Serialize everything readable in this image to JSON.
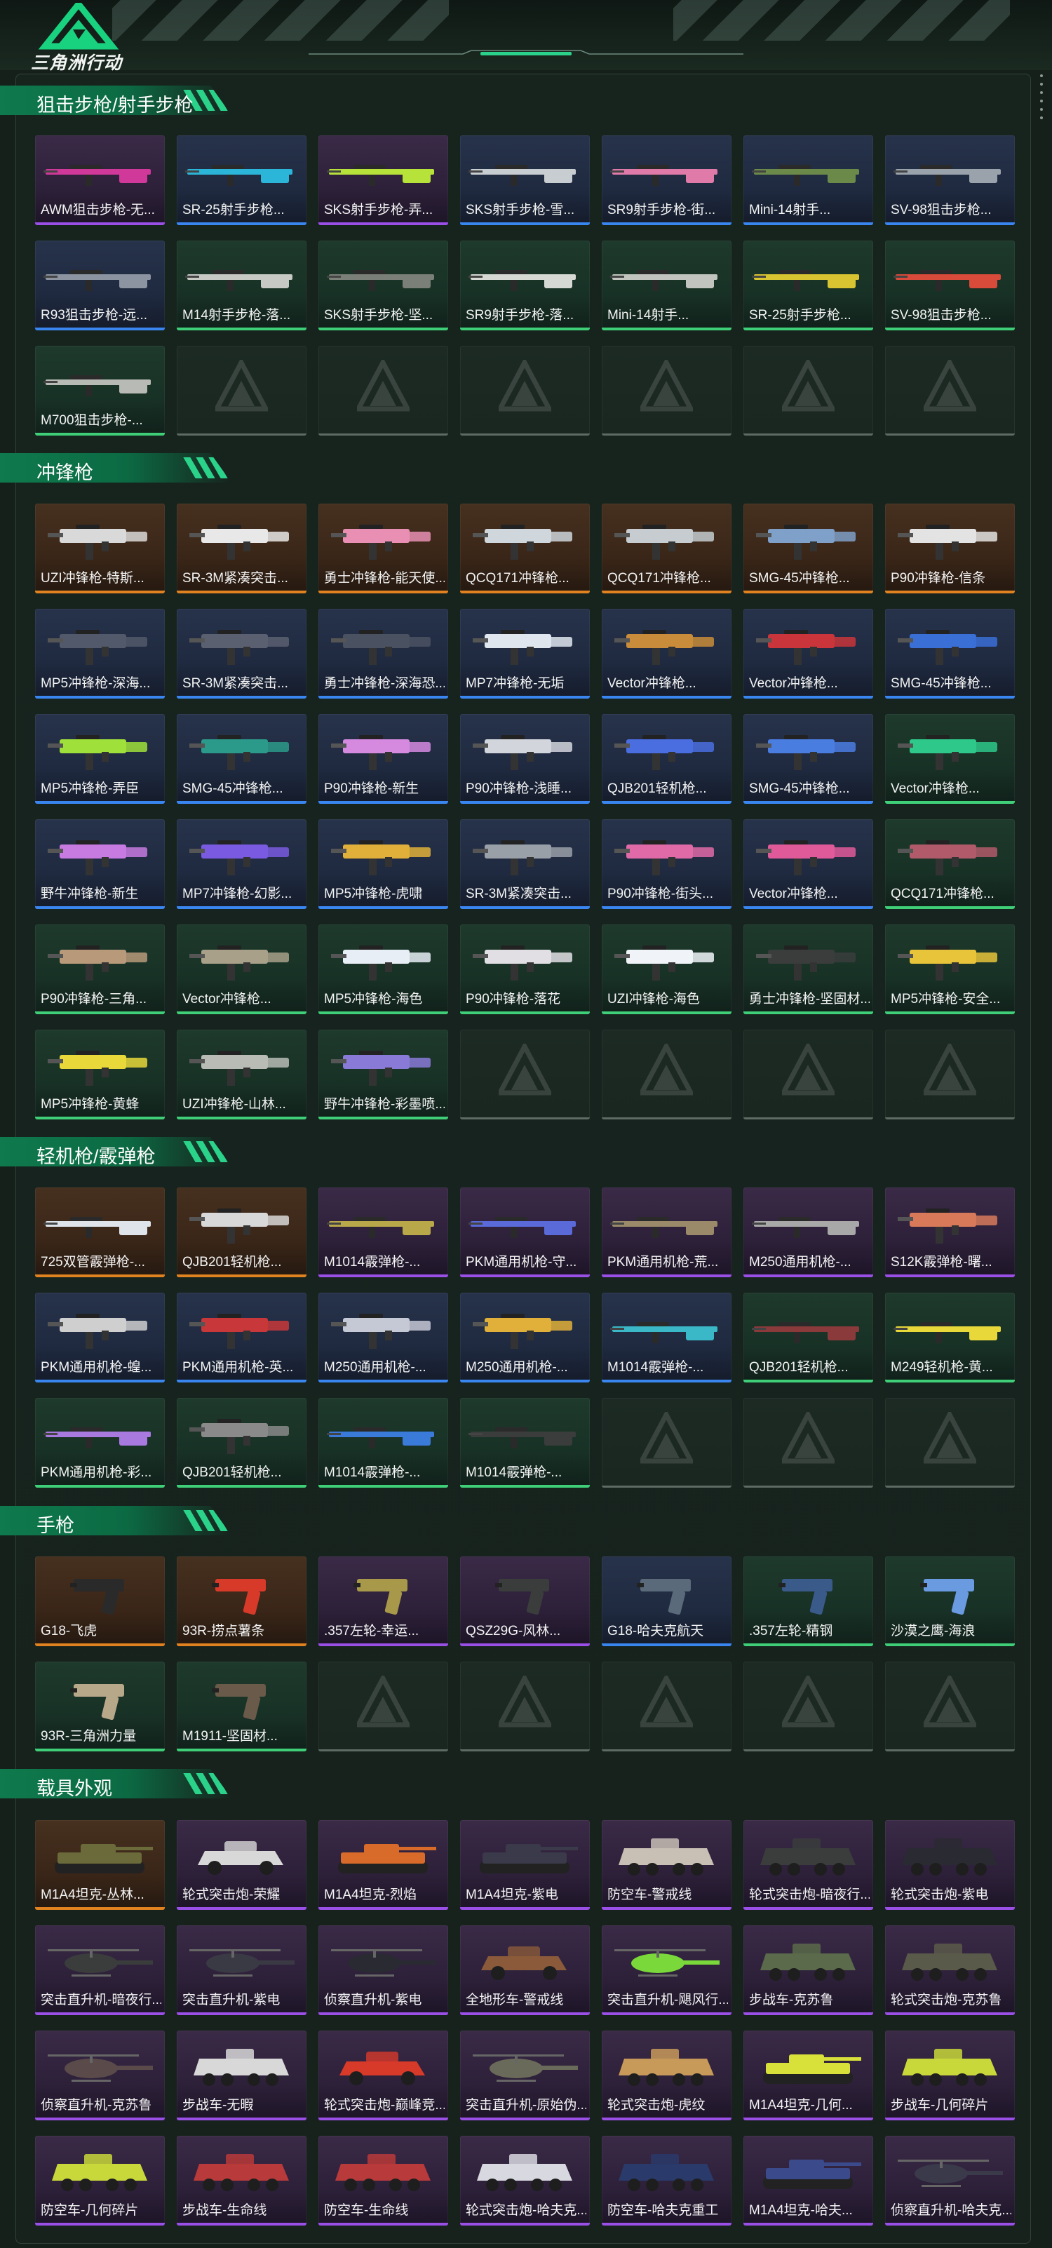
{
  "app": {
    "logo_text": "三角洲行动"
  },
  "colors": {
    "accent": "#0e7a4d",
    "gold": "#e0821f",
    "purple": "#9a4fe6",
    "blue": "#3a86f0",
    "green": "#3fcf78",
    "empty": "#5d6b64"
  },
  "sections": [
    {
      "title": "狙击步枪/射手步枪",
      "items": [
        {
          "label": "AWM狙击步枪-无...",
          "quality": "purple",
          "kind": "rifle",
          "color": "#d0389a"
        },
        {
          "label": "SR-25射手步枪...",
          "quality": "blue",
          "kind": "rifle",
          "color": "#2bb5d8"
        },
        {
          "label": "SKS射手步枪-弄...",
          "quality": "purple",
          "kind": "rifle",
          "color": "#b7e23a"
        },
        {
          "label": "SKS射手步枪-雪...",
          "quality": "blue",
          "kind": "rifle",
          "color": "#c8cdd2"
        },
        {
          "label": "SR9射手步枪-街...",
          "quality": "blue",
          "kind": "rifle",
          "color": "#e07aa8"
        },
        {
          "label": "Mini-14射手...",
          "quality": "blue",
          "kind": "rifle",
          "color": "#6b8a4a"
        },
        {
          "label": "SV-98狙击步枪...",
          "quality": "blue",
          "kind": "rifle",
          "color": "#9aa3ab"
        },
        {
          "label": "R93狙击步枪-远...",
          "quality": "blue",
          "kind": "rifle",
          "color": "#8b94a0"
        },
        {
          "label": "M14射手步枪-落...",
          "quality": "green",
          "kind": "rifle",
          "color": "#c7c9c4"
        },
        {
          "label": "SKS射手步枪-坚...",
          "quality": "green",
          "kind": "rifle",
          "color": "#7a7f77"
        },
        {
          "label": "SR9射手步枪-落...",
          "quality": "green",
          "kind": "rifle",
          "color": "#d5d8d3"
        },
        {
          "label": "Mini-14射手...",
          "quality": "green",
          "kind": "rifle",
          "color": "#c1c4bf"
        },
        {
          "label": "SR-25射手步枪...",
          "quality": "green",
          "kind": "rifle",
          "color": "#d8c431"
        },
        {
          "label": "SV-98狙击步枪...",
          "quality": "green",
          "kind": "rifle",
          "color": "#d84a3a"
        },
        {
          "label": "M700狙击步枪-...",
          "quality": "green",
          "kind": "rifle",
          "color": "#b8bab5"
        },
        {
          "label": "",
          "quality": "empty"
        },
        {
          "label": "",
          "quality": "empty"
        },
        {
          "label": "",
          "quality": "empty"
        },
        {
          "label": "",
          "quality": "empty"
        },
        {
          "label": "",
          "quality": "empty"
        },
        {
          "label": "",
          "quality": "empty"
        }
      ]
    },
    {
      "title": "冲锋枪",
      "items": [
        {
          "label": "UZI冲锋枪-特斯...",
          "quality": "gold",
          "kind": "smg",
          "color": "#d9d9d9"
        },
        {
          "label": "SR-3M紧凑突击...",
          "quality": "gold",
          "kind": "smg",
          "color": "#e8e8e8"
        },
        {
          "label": "勇士冲锋枪-能天使...",
          "quality": "gold",
          "kind": "smg",
          "color": "#e98fb4"
        },
        {
          "label": "QCQ171冲锋枪...",
          "quality": "gold",
          "kind": "smg",
          "color": "#cfd6dc"
        },
        {
          "label": "QCQ171冲锋枪...",
          "quality": "gold",
          "kind": "smg",
          "color": "#c6ccd0"
        },
        {
          "label": "SMG-45冲锋枪...",
          "quality": "gold",
          "kind": "smg",
          "color": "#7fa0c8"
        },
        {
          "label": "P90冲锋枪-信条",
          "quality": "gold",
          "kind": "smg",
          "color": "#e3e3e3"
        },
        {
          "label": "MP5冲锋枪-深海...",
          "quality": "blue",
          "kind": "smg",
          "color": "#51596a"
        },
        {
          "label": "SR-3M紧凑突击...",
          "quality": "blue",
          "kind": "smg",
          "color": "#5a6070"
        },
        {
          "label": "勇士冲锋枪-深海恐...",
          "quality": "blue",
          "kind": "smg",
          "color": "#4a5262"
        },
        {
          "label": "MP7冲锋枪-无垢",
          "quality": "blue",
          "kind": "smg",
          "color": "#dfe6ee"
        },
        {
          "label": "Vector冲锋枪...",
          "quality": "blue",
          "kind": "smg",
          "color": "#c98c3a"
        },
        {
          "label": "Vector冲锋枪...",
          "quality": "blue",
          "kind": "smg",
          "color": "#c9353a"
        },
        {
          "label": "SMG-45冲锋枪...",
          "quality": "blue",
          "kind": "smg",
          "color": "#3a6fd6"
        },
        {
          "label": "MP5冲锋枪-弄臣",
          "quality": "blue",
          "kind": "smg",
          "color": "#9fe03a"
        },
        {
          "label": "SMG-45冲锋枪...",
          "quality": "blue",
          "kind": "smg",
          "color": "#2b9a8a"
        },
        {
          "label": "P90冲锋枪-新生",
          "quality": "blue",
          "kind": "smg",
          "color": "#d58ae0"
        },
        {
          "label": "P90冲锋枪-浅睡...",
          "quality": "blue",
          "kind": "smg",
          "color": "#d2d5dc"
        },
        {
          "label": "QJB201轻机枪...",
          "quality": "blue",
          "kind": "smg",
          "color": "#4a6de0"
        },
        {
          "label": "SMG-45冲锋枪...",
          "quality": "blue",
          "kind": "smg",
          "color": "#4a7de0"
        },
        {
          "label": "Vector冲锋枪...",
          "quality": "green",
          "kind": "smg",
          "color": "#2ec88a"
        },
        {
          "label": "野牛冲锋枪-新生",
          "quality": "blue",
          "kind": "smg",
          "color": "#c77ae0"
        },
        {
          "label": "MP7冲锋枪-幻影...",
          "quality": "blue",
          "kind": "smg",
          "color": "#7a5ae0"
        },
        {
          "label": "MP5冲锋枪-虎啸",
          "quality": "blue",
          "kind": "smg",
          "color": "#e0b03a"
        },
        {
          "label": "SR-3M紧凑突击...",
          "quality": "blue",
          "kind": "smg",
          "color": "#9aa0a8"
        },
        {
          "label": "P90冲锋枪-街头...",
          "quality": "blue",
          "kind": "smg",
          "color": "#e06aa8"
        },
        {
          "label": "Vector冲锋枪...",
          "quality": "blue",
          "kind": "smg",
          "color": "#e05a9a"
        },
        {
          "label": "QCQ171冲锋枪...",
          "quality": "green",
          "kind": "smg",
          "color": "#b05a6a"
        },
        {
          "label": "P90冲锋枪-三角...",
          "quality": "green",
          "kind": "smg",
          "color": "#b89a7a"
        },
        {
          "label": "Vector冲锋枪...",
          "quality": "green",
          "kind": "smg",
          "color": "#a8a088"
        },
        {
          "label": "MP5冲锋枪-海色",
          "quality": "green",
          "kind": "smg",
          "color": "#e8eef5"
        },
        {
          "label": "P90冲锋枪-落花",
          "quality": "green",
          "kind": "smg",
          "color": "#e2dfe4"
        },
        {
          "label": "UZI冲锋枪-海色",
          "quality": "green",
          "kind": "smg",
          "color": "#f0f4f8"
        },
        {
          "label": "勇士冲锋枪-坚固材...",
          "quality": "green",
          "kind": "smg",
          "color": "#3a3d3c"
        },
        {
          "label": "MP5冲锋枪-安全...",
          "quality": "green",
          "kind": "smg",
          "color": "#e8c43a"
        },
        {
          "label": "MP5冲锋枪-黄蜂",
          "quality": "green",
          "kind": "smg",
          "color": "#e8d83a"
        },
        {
          "label": "UZI冲锋枪-山林...",
          "quality": "green",
          "kind": "smg",
          "color": "#b8bcb5"
        },
        {
          "label": "野牛冲锋枪-彩墨喷...",
          "quality": "green",
          "kind": "smg",
          "color": "#8a7ad8"
        },
        {
          "label": "",
          "quality": "empty"
        },
        {
          "label": "",
          "quality": "empty"
        },
        {
          "label": "",
          "quality": "empty"
        },
        {
          "label": "",
          "quality": "empty"
        }
      ]
    },
    {
      "title": "轻机枪/霰弹枪",
      "items": [
        {
          "label": "725双管霰弹枪-...",
          "quality": "gold",
          "kind": "rifle",
          "color": "#dfe4ea"
        },
        {
          "label": "QJB201轻机枪...",
          "quality": "gold",
          "kind": "smg",
          "color": "#d8d8d8"
        },
        {
          "label": "M1014霰弹枪-...",
          "quality": "purple",
          "kind": "rifle",
          "color": "#b8a84a"
        },
        {
          "label": "PKM通用机枪-守...",
          "quality": "purple",
          "kind": "rifle",
          "color": "#5a6ad8"
        },
        {
          "label": "PKM通用机枪-荒...",
          "quality": "purple",
          "kind": "rifle",
          "color": "#9a8a6a"
        },
        {
          "label": "M250通用机枪-...",
          "quality": "purple",
          "kind": "rifle",
          "color": "#a8a8a8"
        },
        {
          "label": "S12K霰弹枪-曙...",
          "quality": "purple",
          "kind": "smg",
          "color": "#d87a5a"
        },
        {
          "label": "PKM通用机枪-蝗...",
          "quality": "blue",
          "kind": "smg",
          "color": "#cfcfcf"
        },
        {
          "label": "PKM通用机枪-英...",
          "quality": "blue",
          "kind": "smg",
          "color": "#c8383a"
        },
        {
          "label": "M250通用机枪-...",
          "quality": "blue",
          "kind": "smg",
          "color": "#c5c8d5"
        },
        {
          "label": "M250通用机枪-...",
          "quality": "blue",
          "kind": "smg",
          "color": "#e0b03a"
        },
        {
          "label": "M1014霰弹枪-...",
          "quality": "blue",
          "kind": "rifle",
          "color": "#3ab8c8"
        },
        {
          "label": "QJB201轻机枪...",
          "quality": "green",
          "kind": "rifle",
          "color": "#8a3a3a"
        },
        {
          "label": "M249轻机枪-黄...",
          "quality": "green",
          "kind": "rifle",
          "color": "#e8d83a"
        },
        {
          "label": "PKM通用机枪-彩...",
          "quality": "green",
          "kind": "rifle",
          "color": "#a87ae0"
        },
        {
          "label": "QJB201轻机枪...",
          "quality": "green",
          "kind": "smg",
          "color": "#8a8a8a"
        },
        {
          "label": "M1014霰弹枪-...",
          "quality": "green",
          "kind": "rifle",
          "color": "#3a7ad8"
        },
        {
          "label": "M1014霰弹枪-...",
          "quality": "green",
          "kind": "rifle",
          "color": "#3a3d3c"
        },
        {
          "label": "",
          "quality": "empty"
        },
        {
          "label": "",
          "quality": "empty"
        },
        {
          "label": "",
          "quality": "empty"
        }
      ]
    },
    {
      "title": "手枪",
      "items": [
        {
          "label": "G18-飞虎",
          "quality": "gold",
          "kind": "pistol",
          "color": "#2a2a2a"
        },
        {
          "label": "93R-捞点薯条",
          "quality": "gold",
          "kind": "pistol",
          "color": "#d83a2a"
        },
        {
          "label": ".357左轮-幸运...",
          "quality": "purple",
          "kind": "pistol",
          "color": "#a8984a"
        },
        {
          "label": "QSZ29G-风林...",
          "quality": "purple",
          "kind": "pistol",
          "color": "#3a3d3c"
        },
        {
          "label": "G18-哈夫克航天",
          "quality": "blue",
          "kind": "pistol",
          "color": "#5a6a7a"
        },
        {
          "label": ".357左轮-精钢",
          "quality": "green",
          "kind": "pistol",
          "color": "#3a5a8a"
        },
        {
          "label": "沙漠之鹰-海浪",
          "quality": "green",
          "kind": "pistol",
          "color": "#6a9ae0"
        },
        {
          "label": "93R-三角洲力量",
          "quality": "green",
          "kind": "pistol",
          "color": "#b8a88a"
        },
        {
          "label": "M1911-坚固材...",
          "quality": "green",
          "kind": "pistol",
          "color": "#6a5a4a"
        },
        {
          "label": "",
          "quality": "empty"
        },
        {
          "label": "",
          "quality": "empty"
        },
        {
          "label": "",
          "quality": "empty"
        },
        {
          "label": "",
          "quality": "empty"
        },
        {
          "label": "",
          "quality": "empty"
        }
      ]
    },
    {
      "title": "载具外观",
      "items": [
        {
          "label": "M1A4坦克-丛林...",
          "quality": "gold",
          "kind": "tank",
          "color": "#6a6a3a"
        },
        {
          "label": "轮式突击炮-荣耀",
          "quality": "purple",
          "kind": "car",
          "color": "#d8d8d8"
        },
        {
          "label": "M1A4坦克-烈焰",
          "quality": "purple",
          "kind": "tank",
          "color": "#d86a2a"
        },
        {
          "label": "M1A4坦克-紫电",
          "quality": "purple",
          "kind": "tank",
          "color": "#3a3a4a"
        },
        {
          "label": "防空车-警戒线",
          "quality": "purple",
          "kind": "apc",
          "color": "#c8c0b5"
        },
        {
          "label": "轮式突击炮-暗夜行...",
          "quality": "purple",
          "kind": "apc",
          "color": "#3a3d3c"
        },
        {
          "label": "轮式突击炮-紫电",
          "quality": "purple",
          "kind": "apc",
          "color": "#2a2a33"
        },
        {
          "label": "突击直升机-暗夜行...",
          "quality": "purple",
          "kind": "heli",
          "color": "#3a3d3c"
        },
        {
          "label": "突击直升机-紫电",
          "quality": "purple",
          "kind": "heli",
          "color": "#3a3a44"
        },
        {
          "label": "侦察直升机-紫电",
          "quality": "purple",
          "kind": "heli",
          "color": "#2a2a33"
        },
        {
          "label": "全地形车-警戒线",
          "quality": "purple",
          "kind": "car",
          "color": "#8a5a3a"
        },
        {
          "label": "突击直升机-飓风行...",
          "quality": "purple",
          "kind": "heli",
          "color": "#7ad83a"
        },
        {
          "label": "步战车-克苏鲁",
          "quality": "purple",
          "kind": "apc",
          "color": "#5a6a4a"
        },
        {
          "label": "轮式突击炮-克苏鲁",
          "quality": "purple",
          "kind": "apc",
          "color": "#5a5a4a"
        },
        {
          "label": "侦察直升机-克苏鲁",
          "quality": "purple",
          "kind": "heli",
          "color": "#5a4a4a"
        },
        {
          "label": "步战车-无暇",
          "quality": "purple",
          "kind": "apc",
          "color": "#d8d8d8"
        },
        {
          "label": "轮式突击炮-巅峰竞...",
          "quality": "purple",
          "kind": "car",
          "color": "#d83a2a"
        },
        {
          "label": "突击直升机-原始伪...",
          "quality": "purple",
          "kind": "heli",
          "color": "#6a6a5a"
        },
        {
          "label": "轮式突击炮-虎纹",
          "quality": "purple",
          "kind": "apc",
          "color": "#c89a5a"
        },
        {
          "label": "M1A4坦克-几何...",
          "quality": "purple",
          "kind": "tank",
          "color": "#d8e03a"
        },
        {
          "label": "步战车-几何碎片",
          "quality": "purple",
          "kind": "apc",
          "color": "#c8d83a"
        },
        {
          "label": "防空车-几何碎片",
          "quality": "purple",
          "kind": "apc",
          "color": "#c8d83a"
        },
        {
          "label": "步战车-生命线",
          "quality": "purple",
          "kind": "apc",
          "color": "#b83a3a"
        },
        {
          "label": "防空车-生命线",
          "quality": "purple",
          "kind": "apc",
          "color": "#b83a3a"
        },
        {
          "label": "轮式突击炮-哈夫克...",
          "quality": "purple",
          "kind": "apc",
          "color": "#d8d8e0"
        },
        {
          "label": "防空车-哈夫克重工",
          "quality": "purple",
          "kind": "apc",
          "color": "#2a3a6a"
        },
        {
          "label": "M1A4坦克-哈夫...",
          "quality": "purple",
          "kind": "tank",
          "color": "#3a4a8a"
        },
        {
          "label": "侦察直升机-哈夫克...",
          "quality": "purple",
          "kind": "heli",
          "color": "#3a3a4a"
        }
      ]
    }
  ]
}
